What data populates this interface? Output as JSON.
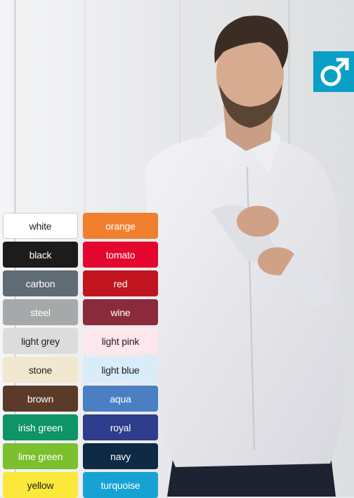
{
  "badge": {
    "icon": "male-symbol-icon",
    "background": "#0a9fc6"
  },
  "swatches": [
    {
      "label": "white",
      "bg": "#ffffff",
      "fg": "#222222",
      "border": "#cfcfcf"
    },
    {
      "label": "orange",
      "bg": "#f07f2e",
      "fg": "#ffffff"
    },
    {
      "label": "black",
      "bg": "#1c1c1c",
      "fg": "#ffffff"
    },
    {
      "label": "tomato",
      "bg": "#e4062d",
      "fg": "#ffffff"
    },
    {
      "label": "carbon",
      "bg": "#5f6b75",
      "fg": "#ffffff"
    },
    {
      "label": "red",
      "bg": "#c0151e",
      "fg": "#ffffff"
    },
    {
      "label": "steel",
      "bg": "#a6a8aa",
      "fg": "#ffffff"
    },
    {
      "label": "wine",
      "bg": "#8b2a3a",
      "fg": "#ffffff"
    },
    {
      "label": "light grey",
      "bg": "#dcdcdc",
      "fg": "#222222"
    },
    {
      "label": "light pink",
      "bg": "#fde6ec",
      "fg": "#222222"
    },
    {
      "label": "stone",
      "bg": "#f2e7cf",
      "fg": "#222222"
    },
    {
      "label": "light blue",
      "bg": "#d9ecfa",
      "fg": "#222222"
    },
    {
      "label": "brown",
      "bg": "#5b3b27",
      "fg": "#ffffff"
    },
    {
      "label": "aqua",
      "bg": "#4a7fc4",
      "fg": "#ffffff"
    },
    {
      "label": "irish green",
      "bg": "#0e9466",
      "fg": "#ffffff"
    },
    {
      "label": "royal",
      "bg": "#2e3d8c",
      "fg": "#ffffff"
    },
    {
      "label": "lime green",
      "bg": "#7cbf2f",
      "fg": "#ffffff"
    },
    {
      "label": "navy",
      "bg": "#0e2a45",
      "fg": "#ffffff"
    },
    {
      "label": "yellow",
      "bg": "#fce83b",
      "fg": "#222222"
    },
    {
      "label": "turquoise",
      "bg": "#16a3d3",
      "fg": "#ffffff"
    }
  ]
}
